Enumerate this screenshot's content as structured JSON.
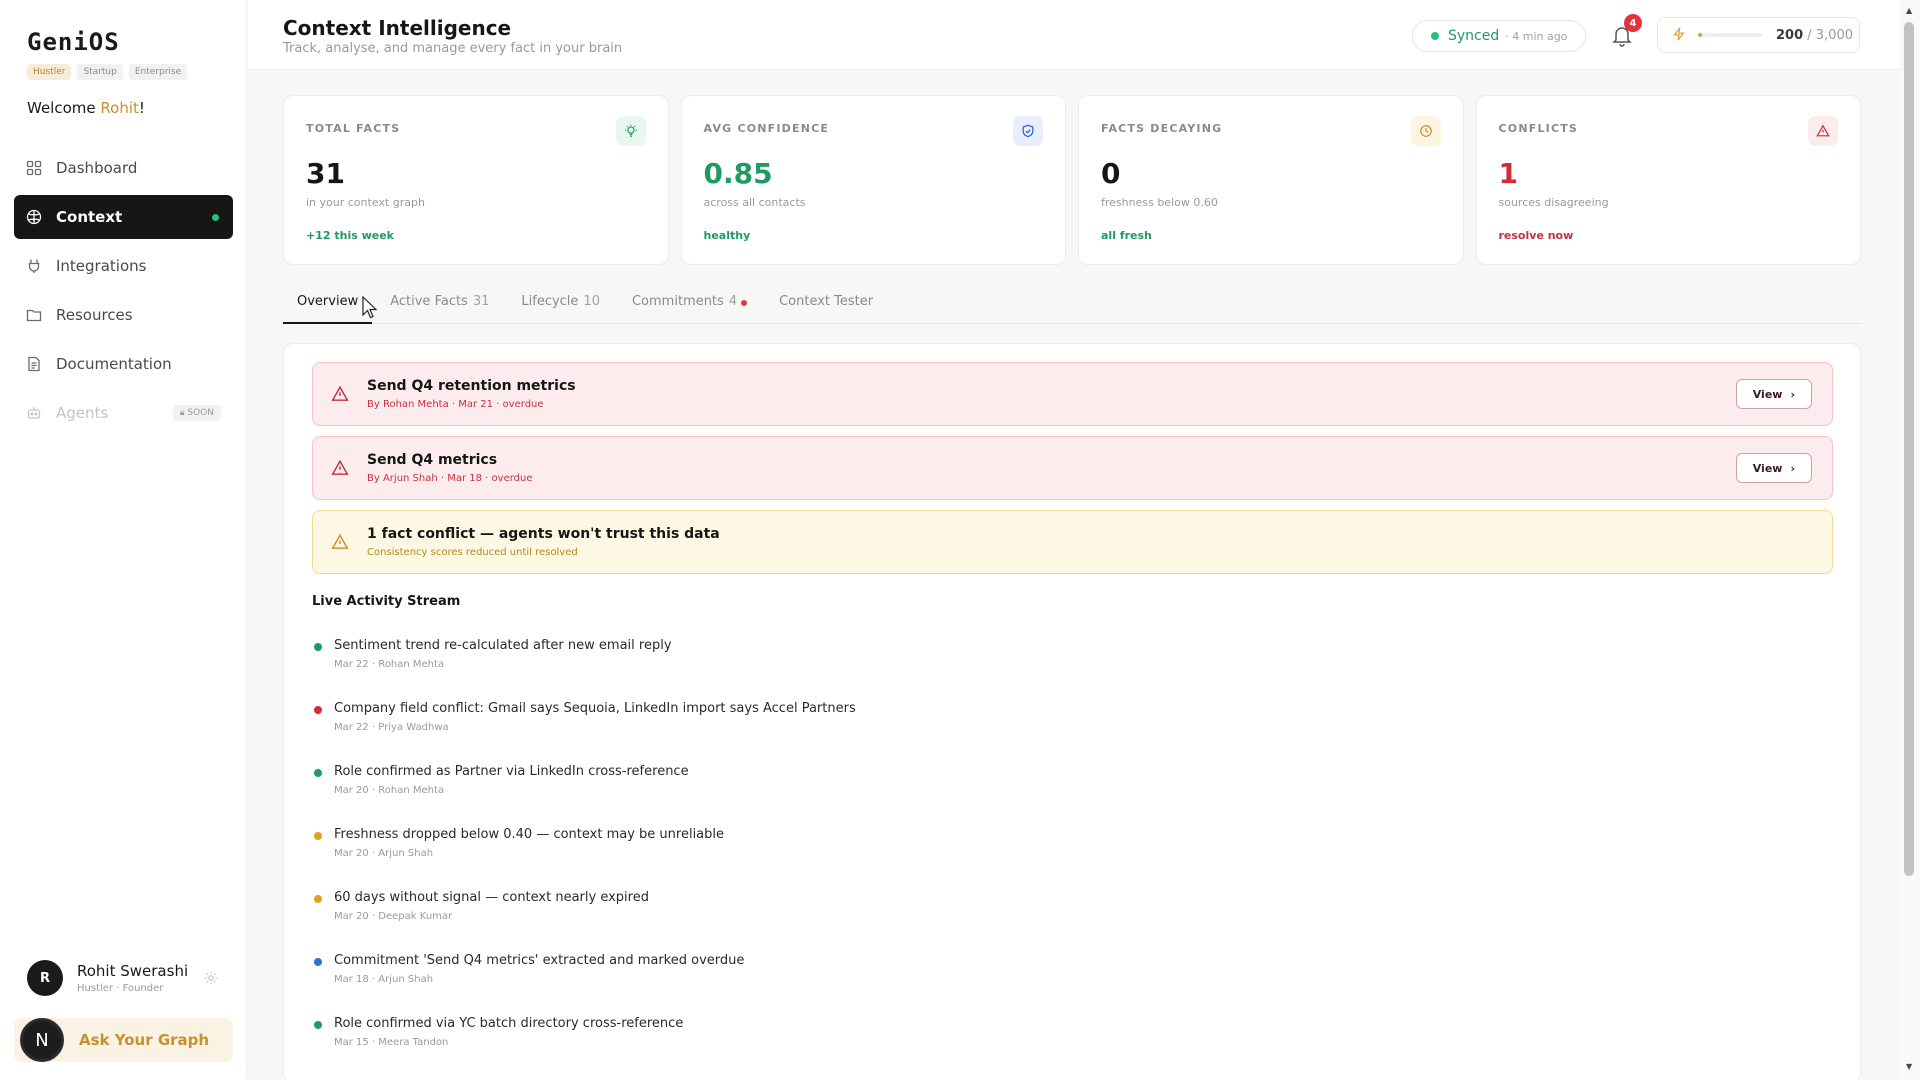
{
  "app": {
    "logo": "GeniOS",
    "plans": [
      "Hustler",
      "Startup",
      "Enterprise"
    ],
    "welcome_prefix": "Welcome ",
    "welcome_name": "Rohit",
    "welcome_suffix": "!"
  },
  "sidebar": {
    "items": [
      {
        "label": "Dashboard",
        "icon": "grid-icon"
      },
      {
        "label": "Context",
        "icon": "brain-icon",
        "active": true
      },
      {
        "label": "Integrations",
        "icon": "plug-icon"
      },
      {
        "label": "Resources",
        "icon": "folder-icon"
      },
      {
        "label": "Documentation",
        "icon": "document-icon"
      },
      {
        "label": "Agents",
        "icon": "robot-icon",
        "disabled": true,
        "badge": "SOON"
      }
    ]
  },
  "user": {
    "initial": "R",
    "name": "Rohit Swerashi",
    "role": "Hustler · Founder"
  },
  "ask": {
    "avatar": "N",
    "label": "Ask Your Graph"
  },
  "header": {
    "title": "Context Intelligence",
    "subtitle": "Track, analyse, and manage every fact in your brain",
    "sync_status": "Synced",
    "sync_time": "· 4 min ago",
    "notifications": "4",
    "credits_used": "200",
    "credits_total": " / 3,000",
    "credits_fraction": 0.067
  },
  "stats": [
    {
      "label": "TOTAL FACTS",
      "value": "31",
      "sub": "in your context graph",
      "foot": "+12 this week",
      "foot_color": "#1f9a63",
      "value_color": "#161616",
      "icon": "bulb-icon",
      "icon_bg": "#e8f7ef",
      "icon_color": "#1f9a63"
    },
    {
      "label": "AVG CONFIDENCE",
      "value": "0.85",
      "sub": "across all contacts",
      "foot": "healthy",
      "foot_color": "#1f9a63",
      "value_color": "#1f9a63",
      "icon": "shield-icon",
      "icon_bg": "#e8eefc",
      "icon_color": "#2f5fd0"
    },
    {
      "label": "FACTS DECAYING",
      "value": "0",
      "sub": "freshness below 0.60",
      "foot": "all fresh",
      "foot_color": "#1f9a63",
      "value_color": "#161616",
      "icon": "clock-icon",
      "icon_bg": "#fdf5e2",
      "icon_color": "#c8902f"
    },
    {
      "label": "CONFLICTS",
      "value": "1",
      "sub": "sources disagreeing",
      "foot": "resolve now",
      "foot_color": "#c0333f",
      "value_color": "#d12c3a",
      "icon": "warning-icon",
      "icon_bg": "#fdecee",
      "icon_color": "#c0333f"
    }
  ],
  "tabs": [
    {
      "label": "Overview",
      "count": "",
      "active": true
    },
    {
      "label": "Active Facts",
      "count": "31"
    },
    {
      "label": "Lifecycle",
      "count": "10"
    },
    {
      "label": "Commitments",
      "count": "4",
      "dot": true
    },
    {
      "label": "Context Tester",
      "count": ""
    }
  ],
  "alerts": [
    {
      "type": "red",
      "title": "Send Q4 retention metrics",
      "sub": "By Rohan Mehta · Mar 21 · overdue",
      "action": "View"
    },
    {
      "type": "red",
      "title": "Send Q4 metrics",
      "sub": "By Arjun Shah · Mar 18 · overdue",
      "action": "View"
    },
    {
      "type": "yellow",
      "title": "1 fact conflict — agents won't trust this data",
      "sub": "Consistency scores reduced until resolved"
    }
  ],
  "activity": {
    "title": "Live Activity Stream",
    "items": [
      {
        "text": "Sentiment trend re-calculated after new email reply",
        "meta": "Mar 22 · Rohan Mehta",
        "color": "#1f9a63"
      },
      {
        "text": "Company field conflict: Gmail says Sequoia, LinkedIn import says Accel Partners",
        "meta": "Mar 22 · Priya Wadhwa",
        "color": "#d12c3a"
      },
      {
        "text": "Role confirmed as Partner via LinkedIn cross-reference",
        "meta": "Mar 20 · Rohan Mehta",
        "color": "#1f9a63"
      },
      {
        "text": "Freshness dropped below 0.40 — context may be unreliable",
        "meta": "Mar 20 · Arjun Shah",
        "color": "#e0a11b"
      },
      {
        "text": "60 days without signal — context nearly expired",
        "meta": "Mar 20 · Deepak Kumar",
        "color": "#e0a11b"
      },
      {
        "text": "Commitment 'Send Q4 metrics' extracted and marked overdue",
        "meta": "Mar 18 · Arjun Shah",
        "color": "#2f6fd6"
      },
      {
        "text": "Role confirmed via YC batch directory cross-reference",
        "meta": "Mar 15 · Meera Tandon",
        "color": "#1f9a63"
      }
    ]
  }
}
